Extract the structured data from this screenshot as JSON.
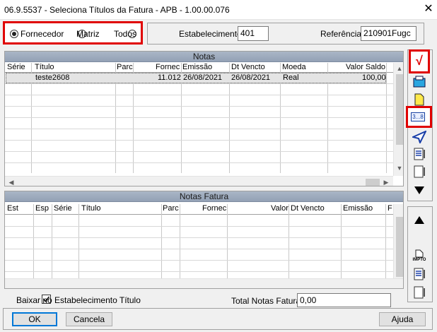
{
  "window": {
    "title": "06.9.5537 - Seleciona Títulos da Fatura - APB - 1.00.00.076",
    "close": "✕"
  },
  "filter": {
    "options": [
      {
        "label": "Fornecedor",
        "selected": true
      },
      {
        "label": "Matriz",
        "selected": false
      },
      {
        "label": "Todos",
        "selected": false
      }
    ]
  },
  "establishment": {
    "label": "Estabelecimento:",
    "value": "401"
  },
  "reference": {
    "label": "Referência:",
    "value": "210901Fugc"
  },
  "notas": {
    "caption": "Notas",
    "columns": [
      "Série",
      "Título",
      "Parc",
      "Fornec",
      "Emissão",
      "Dt Vencto",
      "Moeda",
      "Valor Saldo"
    ],
    "rows": [
      {
        "serie": "",
        "titulo": "teste2608",
        "parc": "",
        "fornec": "11.012",
        "emissao": "26/08/2021",
        "vencto": "26/08/2021",
        "moeda": "Real",
        "valor": "100,00"
      }
    ]
  },
  "notas_fatura": {
    "caption": "Notas Fatura",
    "columns": [
      "Est",
      "Esp",
      "Série",
      "Título",
      "Parc",
      "Fornec",
      "Valor",
      "Dt Vencto",
      "Emissão",
      "F"
    ]
  },
  "bottom": {
    "baixar_label": "Baixar no Estabelecimento Título",
    "baixar_checked": true,
    "total_label": "Total Notas Fatura:",
    "total_value": "0,00"
  },
  "buttons": {
    "ok": "OK",
    "cancel": "Cancela",
    "help": "Ajuda"
  },
  "toolbar": {
    "check_glyph": "√",
    "range_text": "3...8",
    "impto_text": "IMPTO"
  },
  "colors": {
    "highlight": "#e00000",
    "caption_bg": "#9aa7ba",
    "check_red": "#e00000"
  }
}
